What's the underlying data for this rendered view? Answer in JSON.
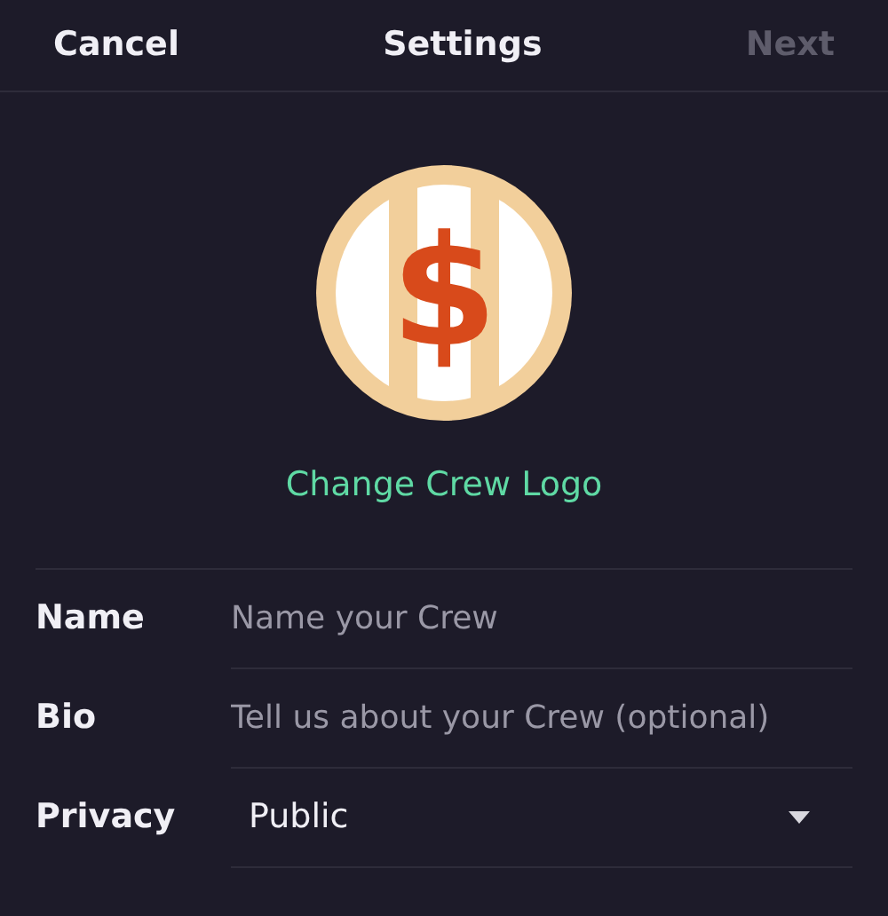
{
  "header": {
    "cancel": "Cancel",
    "title": "Settings",
    "next": {
      "label": "Next",
      "disabled": true
    }
  },
  "logo": {
    "symbol": "$",
    "action": "Change Crew Logo"
  },
  "fields": [
    {
      "kind": "text",
      "label": "Name",
      "placeholder": "Name your Crew"
    },
    {
      "kind": "text",
      "label": "Bio",
      "placeholder": "Tell us about your Crew (optional)"
    },
    {
      "kind": "select",
      "label": "Privacy",
      "value": "Public"
    }
  ]
}
